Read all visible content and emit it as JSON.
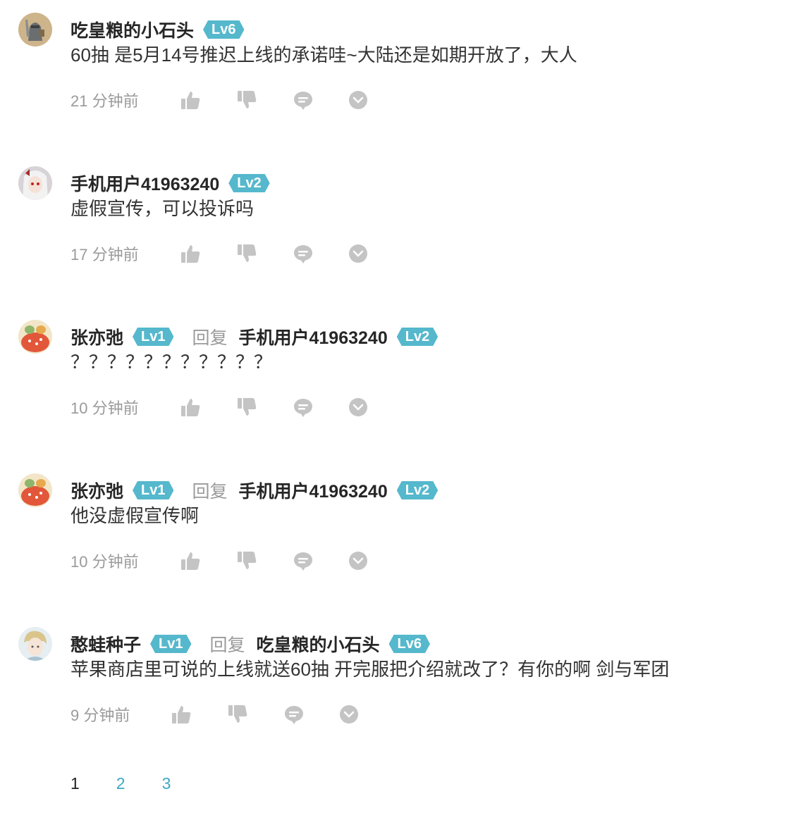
{
  "comments": [
    {
      "username": "吃皇粮的小石头",
      "level": "Lv6",
      "content": "60抽 是5月14号推迟上线的承诺哇~大陆还是如期开放了，大人",
      "time": "21 分钟前"
    },
    {
      "username": "手机用户41963240",
      "level": "Lv2",
      "content": "虚假宣传，可以投诉吗",
      "time": "17 分钟前"
    },
    {
      "username": "张亦弛",
      "level": "Lv1",
      "reply_label": "回复",
      "reply_to": "手机用户41963240",
      "reply_to_level": "Lv2",
      "content": "？？？？？？？？？？？",
      "time": "10 分钟前"
    },
    {
      "username": "张亦弛",
      "level": "Lv1",
      "reply_label": "回复",
      "reply_to": "手机用户41963240",
      "reply_to_level": "Lv2",
      "content": "他没虚假宣传啊",
      "time": "10 分钟前"
    },
    {
      "username": "憨蛙种子",
      "level": "Lv1",
      "reply_label": "回复",
      "reply_to": "吃皇粮的小石头",
      "reply_to_level": "Lv6",
      "content": "苹果商店里可说的上线就送60抽 开完服把介绍就改了？有你的啊 剑与军团",
      "time": "9 分钟前"
    }
  ],
  "pagination": {
    "pages": [
      "1",
      "2",
      "3"
    ],
    "current": "1"
  },
  "icons": {
    "like": "thumbs-up-icon",
    "dislike": "thumbs-down-icon",
    "reply": "comment-bubble-icon",
    "more": "chevron-down-circle-icon"
  },
  "colors": {
    "level_badge": "#55b8cc",
    "icon_gray": "#c4c4c4",
    "page_link": "#3fa8c4"
  }
}
